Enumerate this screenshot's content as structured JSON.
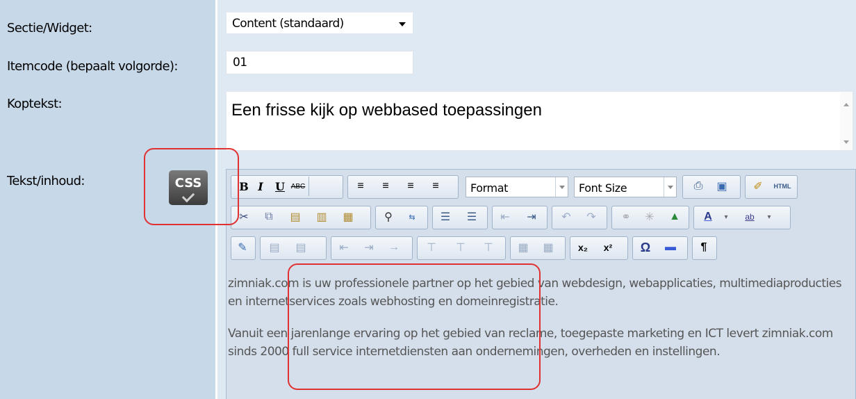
{
  "labels": {
    "section": "Sectie/Widget:",
    "itemcode": "Itemcode (bepaalt volgorde):",
    "heading": "Koptekst:",
    "content": "Tekst/inhoud:"
  },
  "section_select": {
    "value": "Content (standaard)"
  },
  "itemcode_input": {
    "value": "01"
  },
  "heading_text": "Een frisse kijk op webbased toepassingen",
  "css_button": {
    "label": "CSS",
    "icon": "css-check-icon"
  },
  "toolbar": {
    "format_label": "Format",
    "font_size_label": "Font Size",
    "html_label": "HTML",
    "row1": [
      "bold",
      "italic",
      "underline",
      "strikethrough",
      "align-left",
      "align-center",
      "align-right",
      "align-justify",
      "print",
      "source",
      "cleanup"
    ],
    "row2": [
      "cut",
      "copy",
      "paste",
      "paste-text",
      "paste-word",
      "find",
      "replace",
      "bullet-list",
      "number-list",
      "outdent",
      "indent",
      "undo",
      "redo",
      "link",
      "unlink",
      "image",
      "text-color",
      "highlight"
    ],
    "row3": [
      "edit",
      "table-props",
      "row-props",
      "insert-row-before",
      "insert-row-after",
      "delete-row",
      "insert-col-before",
      "insert-col-after",
      "delete-col",
      "split-cell",
      "merge-cell",
      "subscript",
      "superscript",
      "special-char",
      "horizontal-rule",
      "paragraph-mark"
    ]
  },
  "body": {
    "p1": "zimniak.com is uw professionele partner op het gebied van webdesign, webapplicaties, multimediaproducties en internetservices zoals webhosting en domeinregistratie.",
    "p2": "Vanuit een jarenlange ervaring op het gebied van reclame, toegepaste marketing en ICT levert zimniak.com sinds 2000 full service internetdiensten aan ondernemingen, overheden en instellingen."
  },
  "colors": {
    "highlight": "#e03030",
    "label_bg": "#c7d8e9",
    "field_bg": "#dfe9f4"
  }
}
